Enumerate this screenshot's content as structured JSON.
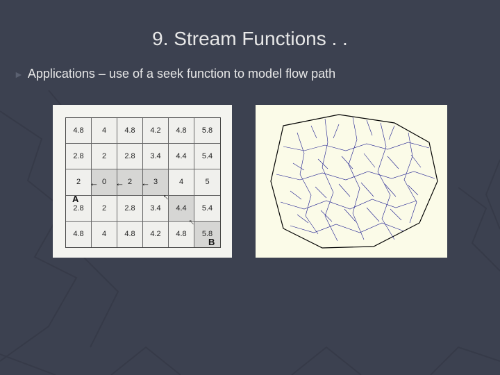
{
  "title": "9. Stream Functions . .",
  "bullet": {
    "text": "Applications – use of a seek function to model flow path"
  },
  "chart_data": {
    "type": "table",
    "title": "Elevation grid with seek-function flow path A→B",
    "columns": 6,
    "rows": 5,
    "values": [
      [
        4.8,
        4,
        4.8,
        4.2,
        4.8,
        5.8
      ],
      [
        2.8,
        2,
        2.8,
        3.4,
        4.4,
        5.4
      ],
      [
        2,
        0,
        2,
        3,
        4,
        5
      ],
      [
        2.8,
        2,
        2.8,
        3.4,
        4.4,
        5.4
      ],
      [
        4.8,
        4,
        4.8,
        4.2,
        4.8,
        5.8
      ]
    ],
    "start_cell": {
      "row": 2,
      "col": 1,
      "label": "A"
    },
    "end_cell": {
      "row": 4,
      "col": 5,
      "label": "B"
    },
    "flow_path_cells": [
      [
        2,
        1
      ],
      [
        2,
        2
      ],
      [
        2,
        3
      ],
      [
        3,
        4
      ],
      [
        4,
        5
      ]
    ],
    "flow_direction": "arrows point from higher cell toward A (sink at value 0)"
  },
  "figure_b_desc": "Drainage network / stream lines of a watershed"
}
